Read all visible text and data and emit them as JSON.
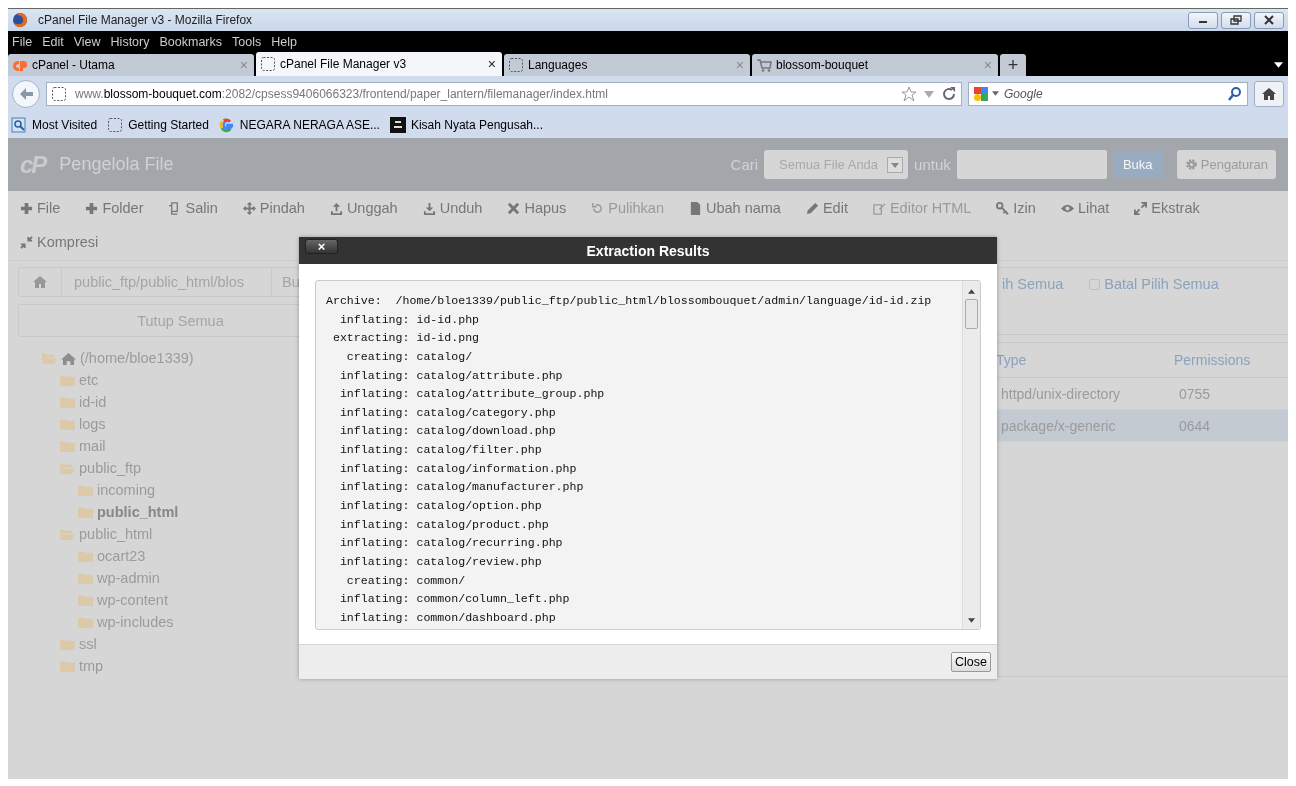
{
  "window": {
    "title": "cPanel File Manager v3 - Mozilla Firefox"
  },
  "menu": [
    "File",
    "Edit",
    "View",
    "History",
    "Bookmarks",
    "Tools",
    "Help"
  ],
  "tabs": [
    {
      "label": "cPanel - Utama",
      "selected": false,
      "close": "×"
    },
    {
      "label": "cPanel File Manager v3",
      "selected": true,
      "close": "×"
    },
    {
      "label": "Languages",
      "selected": false,
      "close": "×"
    },
    {
      "label": "blossom-bouquet",
      "selected": false,
      "close": "×"
    }
  ],
  "new_tab": "+",
  "address": {
    "value": "www.**blossom-bouquet.com**:2082/cpsess9406066323/frontend/paper_lantern/filemanager/index.html"
  },
  "search": {
    "placeholder": "Google"
  },
  "bookmarks": [
    {
      "label": "Most Visited"
    },
    {
      "label": "Getting Started"
    },
    {
      "label": "NEGARA NERAGA ASE..."
    },
    {
      "label": "Kisah Nyata Pengusah..."
    }
  ],
  "app": {
    "logo": "cP",
    "title": "Pengelola File",
    "search_label": "Cari",
    "scope": "Semua File Anda",
    "for_label": "untuk",
    "go": "Buka",
    "settings": "Pengaturan"
  },
  "toolbar": {
    "rows": [
      [
        {
          "label": "File",
          "disabled": false
        },
        {
          "label": "Folder",
          "disabled": false
        },
        {
          "label": "Salin",
          "disabled": false
        },
        {
          "label": "Pindah",
          "disabled": false
        },
        {
          "label": "Unggah",
          "disabled": false
        },
        {
          "label": "Unduh",
          "disabled": false
        },
        {
          "label": "Hapus",
          "disabled": false
        },
        {
          "label": "Pulihkan",
          "disabled": true
        },
        {
          "label": "Ubah nama",
          "disabled": false
        },
        {
          "label": "Edit",
          "disabled": false
        },
        {
          "label": "Editor HTML",
          "disabled": true
        },
        {
          "label": "Izin",
          "disabled": false
        },
        {
          "label": "Lihat",
          "disabled": false
        },
        {
          "label": "Ekstrak",
          "disabled": false
        }
      ],
      [
        {
          "label": "Kompresi",
          "disabled": false
        }
      ]
    ]
  },
  "breadcrumb": {
    "path": "public_ftp/public_html/blos",
    "button": "Bu"
  },
  "collapse_all": "Tutup Semua",
  "tree": [
    {
      "label": "(/home/bloe1339)",
      "kind": "home",
      "expanded": true,
      "selected": false,
      "children": [
        {
          "label": "etc",
          "kind": "folder",
          "expanded": false,
          "selected": false
        },
        {
          "label": "id-id",
          "kind": "folder",
          "expanded": false,
          "selected": false
        },
        {
          "label": "logs",
          "kind": "folder",
          "expanded": false,
          "selected": false
        },
        {
          "label": "mail",
          "kind": "folder",
          "expanded": false,
          "selected": false
        },
        {
          "label": "public_ftp",
          "kind": "folder",
          "expanded": true,
          "selected": false,
          "children": [
            {
              "label": "incoming",
              "kind": "folder",
              "expanded": false,
              "selected": false
            },
            {
              "label": "public_html",
              "kind": "folder",
              "expanded": false,
              "selected": true
            }
          ]
        },
        {
          "label": "public_html",
          "kind": "folder",
          "expanded": true,
          "selected": false,
          "children": [
            {
              "label": "ocart23",
              "kind": "folder",
              "expanded": false,
              "selected": false
            },
            {
              "label": "wp-admin",
              "kind": "folder",
              "expanded": false,
              "selected": false
            },
            {
              "label": "wp-content",
              "kind": "folder",
              "expanded": false,
              "selected": false
            },
            {
              "label": "wp-includes",
              "kind": "folder",
              "expanded": false,
              "selected": false
            }
          ]
        },
        {
          "label": "ssl",
          "kind": "folder",
          "expanded": false,
          "selected": false
        },
        {
          "label": "tmp",
          "kind": "folder",
          "expanded": false,
          "selected": false
        }
      ]
    }
  ],
  "selection": [
    {
      "label": "ih Semua",
      "checkbox": false
    },
    {
      "label": "Batal Pilih Semua",
      "checkbox": true
    }
  ],
  "table": {
    "columns": [
      "Type",
      "Permissions"
    ],
    "rows": [
      {
        "cells": [
          "httpd/unix-directory",
          "0755"
        ],
        "selected": false
      },
      {
        "cells": [
          "package/x-generic",
          "0644"
        ],
        "selected": true
      }
    ]
  },
  "dialog": {
    "title": "Extraction Results",
    "close": "×",
    "button": "Close",
    "log": [
      "Archive:  /home/bloe1339/public_ftp/public_html/blossombouquet/admin/language/id-id.zip",
      "  inflating: id-id.php",
      " extracting: id-id.png",
      "   creating: catalog/",
      "  inflating: catalog/attribute.php",
      "  inflating: catalog/attribute_group.php",
      "  inflating: catalog/category.php",
      "  inflating: catalog/download.php",
      "  inflating: catalog/filter.php",
      "  inflating: catalog/information.php",
      "  inflating: catalog/manufacturer.php",
      "  inflating: catalog/option.php",
      "  inflating: catalog/product.php",
      "  inflating: catalog/recurring.php",
      "  inflating: catalog/review.php",
      "   creating: common/",
      "  inflating: common/column_left.php",
      "  inflating: common/dashboard.php"
    ]
  }
}
